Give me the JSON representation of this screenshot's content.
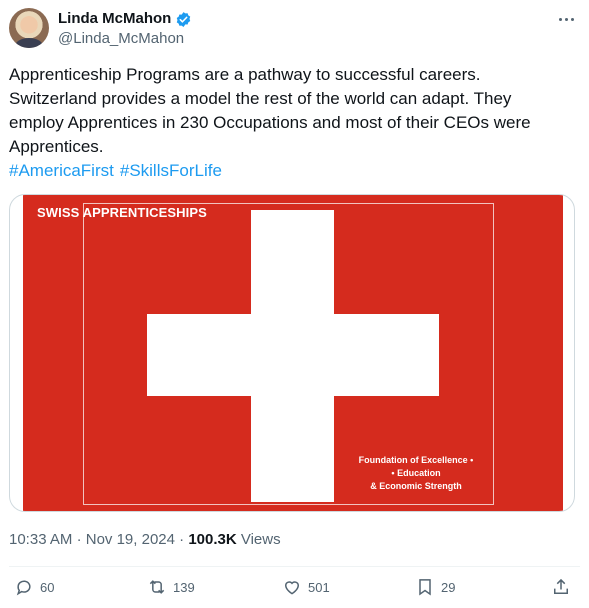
{
  "author": {
    "display_name": "Linda McMahon",
    "handle": "@Linda_McMahon"
  },
  "tweet": {
    "text": "Apprenticeship Programs are a pathway to successful careers. Switzerland provides a model the rest of the world can adapt. They employ Apprentices in 230 Occupations and most of their CEOs were Apprentices.",
    "hashtags": [
      "#AmericaFirst",
      "#SkillsForLife"
    ]
  },
  "media": {
    "title": "SWISS APPRENTICESHIPS",
    "caption_lines": [
      "Foundation of Excellence •",
      "• Education",
      "& Economic Strength"
    ],
    "background_color": "#d52b1e"
  },
  "meta": {
    "time": "10:33 AM",
    "separator": "·",
    "date": "Nov 19, 2024",
    "views_count": "100.3K",
    "views_label": "Views"
  },
  "actions": {
    "replies": "60",
    "retweets": "139",
    "likes": "501",
    "bookmarks": "29"
  },
  "colors": {
    "accent": "#1d9bf0",
    "text": "#0f1419",
    "muted": "#536471"
  }
}
